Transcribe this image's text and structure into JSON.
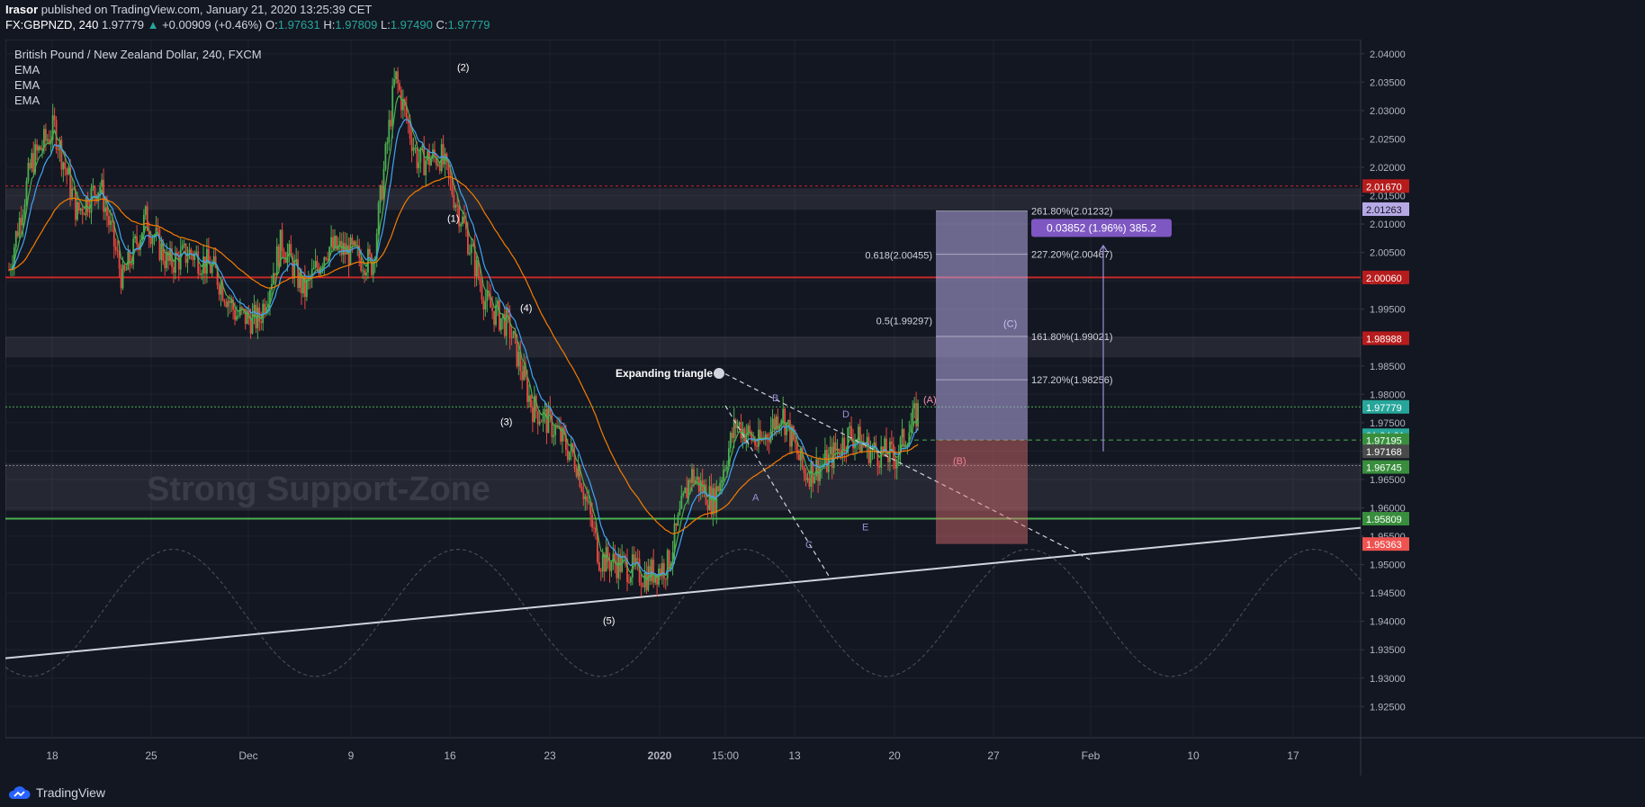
{
  "header": {
    "author": "Irasor",
    "published": "published on TradingView.com, January 21, 2020 13:25:39 CET",
    "symbol": "FX:GBPNZD, 240",
    "last": "1.97779",
    "change": "+0.00909 (+0.46%)",
    "o_label": "O:",
    "o": "1.97631",
    "h_label": "H:",
    "h": "1.97809",
    "l_label": "L:",
    "l": "1.97490",
    "c_label": "C:",
    "c": "1.97779"
  },
  "legend": {
    "title": "British Pound / New Zealand Dollar, 240, FXCM",
    "studies": [
      "EMA",
      "EMA",
      "EMA"
    ]
  },
  "footer": {
    "brand": "TradingView"
  },
  "colors": {
    "background": "#131722",
    "up": "#26a69a",
    "down": "#ef5350",
    "up_candle": "#4caf50",
    "down_candle": "#e84a3f",
    "ema_fast": "#4caf50",
    "ema_mid": "#42a5f5",
    "ema_slow": "#f57c00",
    "resistance": "#c62828",
    "support": "#4caf50"
  },
  "chart_data": {
    "type": "candlestick",
    "interval": "240",
    "ylim": [
      1.9195,
      2.0425
    ],
    "y_ticks": [
      "2.04000",
      "2.03500",
      "2.03000",
      "2.02500",
      "2.02000",
      "2.01500",
      "2.01000",
      "2.00500",
      "2.00000",
      "1.99500",
      "1.99000",
      "1.98500",
      "1.98000",
      "1.97500",
      "1.97000",
      "1.96500",
      "1.96000",
      "1.95500",
      "1.95000",
      "1.94500",
      "1.94000",
      "1.93500",
      "1.93000",
      "1.92500"
    ],
    "x_ticks": [
      {
        "label": "18",
        "i": 0
      },
      {
        "label": "25",
        "i": 1
      },
      {
        "label": "Dec",
        "i": 2
      },
      {
        "label": "9",
        "i": 3
      },
      {
        "label": "16",
        "i": 4
      },
      {
        "label": "23",
        "i": 5
      },
      {
        "label": "2020",
        "i": 6,
        "bold": true
      },
      {
        "label": "15:00",
        "i": 7
      },
      {
        "label": "13",
        "i": 8
      },
      {
        "label": "20",
        "i": 9
      },
      {
        "label": "27",
        "i": 10
      },
      {
        "label": "Feb",
        "i": 11
      },
      {
        "label": "10",
        "i": 12
      },
      {
        "label": "17",
        "i": 13
      }
    ],
    "key_prices": [
      {
        "label": "2.01670",
        "price": 2.0167,
        "color": "#b71c1c"
      },
      {
        "label": "2.01263",
        "price": 2.01263,
        "color": "#b7a9e6",
        "text": "#131722"
      },
      {
        "label": "2.00060",
        "price": 2.0006,
        "color": "#b71c1c"
      },
      {
        "label": "1.98988",
        "price": 1.98988,
        "color": "#b71c1c"
      },
      {
        "label": "1.97779",
        "price": 1.97779,
        "color": "#26a69a"
      },
      {
        "label": "01:34:21",
        "price": 1.9728,
        "color": "#26a69a"
      },
      {
        "label": "1.97195",
        "price": 1.97195,
        "color": "#388e3c"
      },
      {
        "label": "1.97168",
        "price": 1.96995,
        "color": "#4a4a4a"
      },
      {
        "label": "1.96745",
        "price": 1.9672,
        "color": "#388e3c"
      },
      {
        "label": "1.95809",
        "price": 1.95809,
        "color": "#388e3c"
      },
      {
        "label": "1.95363",
        "price": 1.95363,
        "color": "#ef5350"
      }
    ],
    "zones": [
      {
        "from": 2.0125,
        "to": 2.0163
      },
      {
        "from": 1.9865,
        "to": 1.9902
      },
      {
        "from": 1.9595,
        "to": 1.9678
      }
    ],
    "zone_label": "Strong Support-Zone",
    "horizontal_lines": [
      {
        "price": 2.0006,
        "color": "#c62828"
      },
      {
        "price": 1.95809,
        "color": "#4caf50"
      }
    ],
    "trendline": {
      "from": [
        0,
        1.9335
      ],
      "to": [
        1.0,
        1.9565
      ]
    },
    "position": {
      "entry": 1.97195,
      "target": 2.01232,
      "stop": 1.95363,
      "ratio_text": "0.03852 (1.96%) 385.2",
      "levels": [
        {
          "label": "261.80%(2.01232)",
          "price": 2.01232
        },
        {
          "label": "227.20%(2.00467)",
          "price": 2.00467
        },
        {
          "label": "161.80%(1.99021)",
          "price": 1.99021
        },
        {
          "label": "127.20%(1.98256)",
          "price": 1.98256
        }
      ],
      "retracements": [
        {
          "label": "0.618(2.00455)",
          "price": 2.00455
        },
        {
          "label": "0.5(1.99297)",
          "price": 1.99297
        }
      ]
    },
    "wave_labels": [
      "(1)",
      "(2)",
      "(3)",
      "(4)",
      "(5)",
      "A",
      "B",
      "C",
      "D",
      "E",
      "(A)",
      "(B)",
      "(C)"
    ],
    "pattern_label": "Expanding triangle",
    "candle_waypoints": [
      [
        2.002,
        2.01
      ],
      [
        2.021,
        2.015
      ],
      [
        2.027,
        2.022
      ],
      [
        2.012,
        2.008
      ],
      [
        2.017,
        2.003
      ],
      [
        2.0,
        2.005
      ],
      [
        2.011,
        2.007
      ],
      [
        2.003,
        1.998
      ],
      [
        2.005,
        2.009
      ],
      [
        2.002,
        2.006
      ],
      [
        1.994,
        1.988
      ],
      [
        1.993,
        1.995
      ],
      [
        2.007,
        2.003
      ],
      [
        1.998,
        2.001
      ],
      [
        2.006,
        2.011
      ],
      [
        2.005,
        2.003
      ],
      [
        2.003,
        1.996
      ],
      [
        2.036,
        2.039
      ],
      [
        2.021,
        2.028
      ],
      [
        2.022,
        2.018
      ],
      [
        2.01,
        2.004
      ],
      [
        1.996,
        1.992
      ],
      [
        1.992,
        1.985
      ],
      [
        1.978,
        1.971
      ],
      [
        1.974,
        1.978
      ],
      [
        1.968,
        1.961
      ],
      [
        1.951,
        1.953
      ],
      [
        1.95,
        1.946
      ],
      [
        1.948,
        1.951
      ],
      [
        1.95,
        1.948
      ],
      [
        1.966,
        1.968
      ],
      [
        1.961,
        1.965
      ],
      [
        1.975,
        1.982
      ],
      [
        1.971,
        1.968
      ],
      [
        1.977,
        1.976
      ],
      [
        1.966,
        1.958
      ],
      [
        1.968,
        1.97
      ],
      [
        1.973,
        1.968
      ],
      [
        1.97,
        1.966
      ],
      [
        1.969,
        1.972
      ],
      [
        1.977,
        1.978
      ]
    ]
  }
}
